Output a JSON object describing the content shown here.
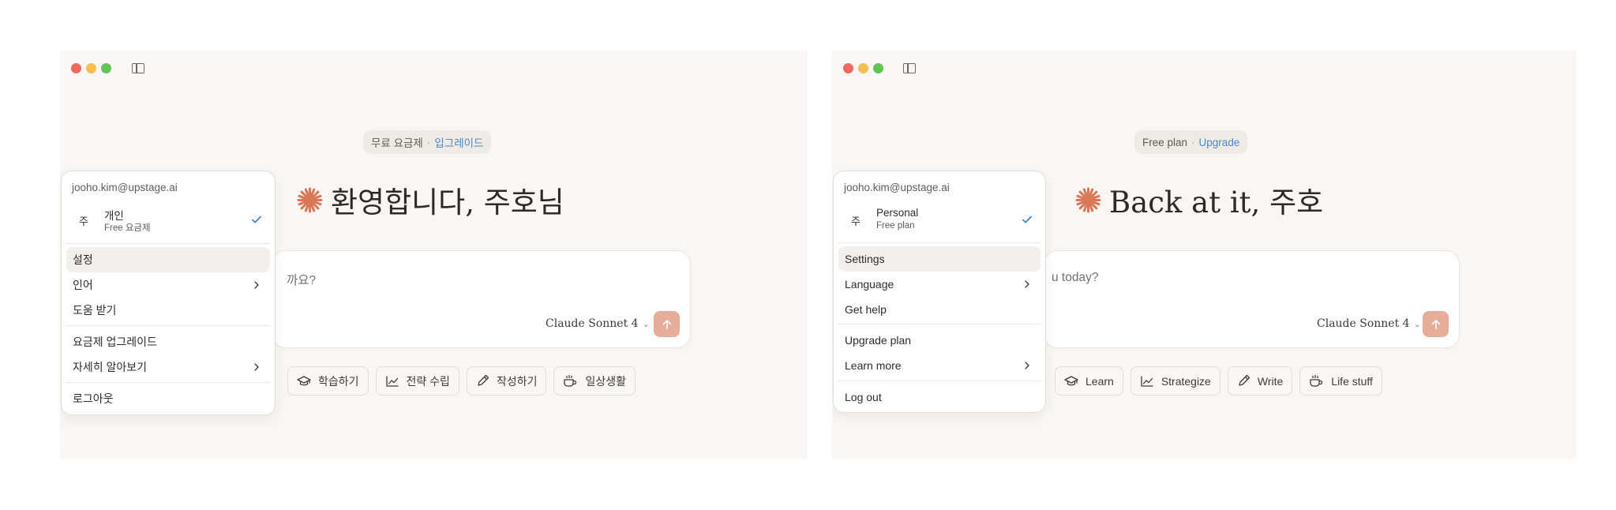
{
  "windows": [
    {
      "plan_pill": {
        "plan": "무료 요금제",
        "separator": "·",
        "upgrade": "입그레이드"
      },
      "greeting": "환영합니다, 주호님",
      "composer": {
        "placeholder": "까요?",
        "model": "Claude Sonnet 4",
        "model_icon": "chevron-down-icon",
        "send_icon": "arrow-up-icon"
      },
      "chips": [
        {
          "label": "학습하기",
          "icon": "graduation-cap-icon"
        },
        {
          "label": "전략 수립",
          "icon": "chart-line-icon"
        },
        {
          "label": "작성하기",
          "icon": "pencil-icon"
        },
        {
          "label": "일상생활",
          "icon": "coffee-cup-icon"
        }
      ],
      "menu": {
        "email": "jooho.kim@upstage.ai",
        "avatar": "주",
        "account_name": "개인",
        "account_plan": "Free 요금제",
        "selected_icon": "check-icon",
        "items": {
          "settings": "설정",
          "language": "인어",
          "help": "도움 받기",
          "upgrade": "요금제 업그레이드",
          "learn_more": "자세히 알아보기",
          "logout": "로그아웃"
        }
      }
    },
    {
      "plan_pill": {
        "plan": "Free plan",
        "separator": "·",
        "upgrade": "Upgrade"
      },
      "greeting": "Back at it, 주호",
      "composer": {
        "placeholder": "u today?",
        "model": "Claude Sonnet 4",
        "model_icon": "chevron-down-icon",
        "send_icon": "arrow-up-icon"
      },
      "chips": [
        {
          "label": "Learn",
          "icon": "graduation-cap-icon"
        },
        {
          "label": "Strategize",
          "icon": "chart-line-icon"
        },
        {
          "label": "Write",
          "icon": "pencil-icon"
        },
        {
          "label": "Life stuff",
          "icon": "coffee-cup-icon"
        }
      ],
      "menu": {
        "email": "jooho.kim@upstage.ai",
        "avatar": "주",
        "account_name": "Personal",
        "account_plan": "Free plan",
        "selected_icon": "check-icon",
        "items": {
          "settings": "Settings",
          "language": "Language",
          "help": "Get help",
          "upgrade": "Upgrade plan",
          "learn_more": "Learn more",
          "logout": "Log out"
        }
      }
    }
  ],
  "colors": {
    "accent": "#d97757",
    "link": "#4a86c8",
    "send_button": "#e5ad9a",
    "window_bg": "#f9f6f3"
  }
}
